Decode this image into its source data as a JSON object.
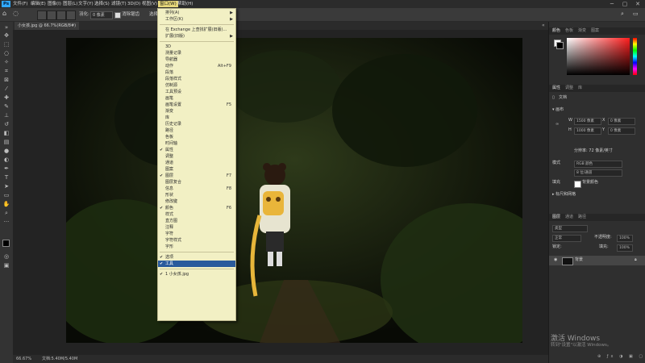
{
  "app": {
    "logo": "Ps",
    "accent": "#e6d77a"
  },
  "menubar": {
    "items": [
      "文件(F)",
      "编辑(E)",
      "图像(I)",
      "图层(L)",
      "文字(Y)",
      "选择(S)",
      "滤镜(T)",
      "3D(D)",
      "视图(V)",
      "增效工具",
      "窗口(W)",
      "帮助(H)"
    ],
    "active_index": 10,
    "window_controls": [
      "─",
      "▢",
      "✕"
    ]
  },
  "options_bar": {
    "feather_label": "羽化:",
    "feather_value": "0 像素",
    "antialias_label": "消除锯齿",
    "select_label": "选择"
  },
  "document": {
    "tab_title": "小女孩.jpg @ 66.7%(RGB/8#)",
    "status_zoom": "66.67%",
    "status_info": "文档:5.40M/5.40M"
  },
  "window_menu": {
    "items": [
      {
        "label": "排列(A)",
        "submenu": true
      },
      {
        "label": "工作区(K)",
        "submenu": true
      },
      {
        "sep": true
      },
      {
        "label": "在 Exchange 上查找扩展(旧版)..."
      },
      {
        "label": "扩展(旧版)",
        "submenu": true
      },
      {
        "sep": true
      },
      {
        "label": "3D"
      },
      {
        "label": "测量记录"
      },
      {
        "label": "导航器"
      },
      {
        "label": "动作",
        "shortcut": "Alt+F9"
      },
      {
        "label": "段落"
      },
      {
        "label": "段落样式"
      },
      {
        "label": "仿制源"
      },
      {
        "label": "工具预设"
      },
      {
        "label": "画笔"
      },
      {
        "label": "画笔设置",
        "shortcut": "F5"
      },
      {
        "label": "渐变"
      },
      {
        "label": "库"
      },
      {
        "label": "历史记录"
      },
      {
        "label": "路径"
      },
      {
        "label": "色板"
      },
      {
        "label": "时间轴"
      },
      {
        "label": "属性",
        "checked": true
      },
      {
        "label": "调整"
      },
      {
        "label": "通道"
      },
      {
        "label": "图案"
      },
      {
        "label": "图层",
        "checked": true,
        "shortcut": "F7"
      },
      {
        "label": "图层复合"
      },
      {
        "label": "信息",
        "shortcut": "F8"
      },
      {
        "label": "形状"
      },
      {
        "label": "修改键"
      },
      {
        "label": "颜色",
        "checked": true,
        "shortcut": "F6"
      },
      {
        "label": "样式"
      },
      {
        "label": "直方图"
      },
      {
        "label": "注释"
      },
      {
        "label": "字符"
      },
      {
        "label": "字符样式"
      },
      {
        "label": "字形"
      },
      {
        "sep": true
      },
      {
        "label": "选项",
        "checked": true
      },
      {
        "label": "工具",
        "checked": true,
        "highlighted": true
      },
      {
        "sep": true
      },
      {
        "label": "1 小女孩.jpg",
        "checked": true
      }
    ]
  },
  "panels": {
    "color_tabs": [
      "颜色",
      "色板",
      "渐变",
      "图案"
    ],
    "properties_tabs": [
      "属性",
      "调整",
      "库"
    ],
    "properties": {
      "doc_label": "文档",
      "canvas_label": "画布",
      "w_label": "W",
      "w_value": "1500 像素",
      "x_label": "X",
      "x_value": "0 像素",
      "h_label": "H",
      "h_value": "1000 像素",
      "y_label": "Y",
      "y_value": "0 像素",
      "resolution": "分辨率: 72 像素/英寸",
      "mode_label": "模式",
      "mode_value": "RGB 颜色",
      "bits_value": "8 位/通道",
      "fill_label": "填充",
      "fill_value": "背景颜色",
      "rulers_label": "标尺和网格"
    },
    "layers_tabs": [
      "图层",
      "通道",
      "路径"
    ],
    "layers": {
      "filter_placeholder": "类型",
      "blend_mode": "正常",
      "opacity_label": "不透明度:",
      "opacity_value": "100%",
      "lock_label": "锁定:",
      "fill_label": "填充:",
      "fill_value": "100%",
      "rows": [
        {
          "name": "背景",
          "locked": true
        }
      ]
    }
  },
  "watermark": {
    "title": "激活 Windows",
    "subtitle": "转到\"设置\"以激活 Windows。"
  },
  "colors": {
    "fg": "#000000",
    "bg": "#ffffff",
    "picker_hue": "#ff1e1e",
    "highlight": "#2a5a9c",
    "menu_bg": "#f2f0c4"
  }
}
